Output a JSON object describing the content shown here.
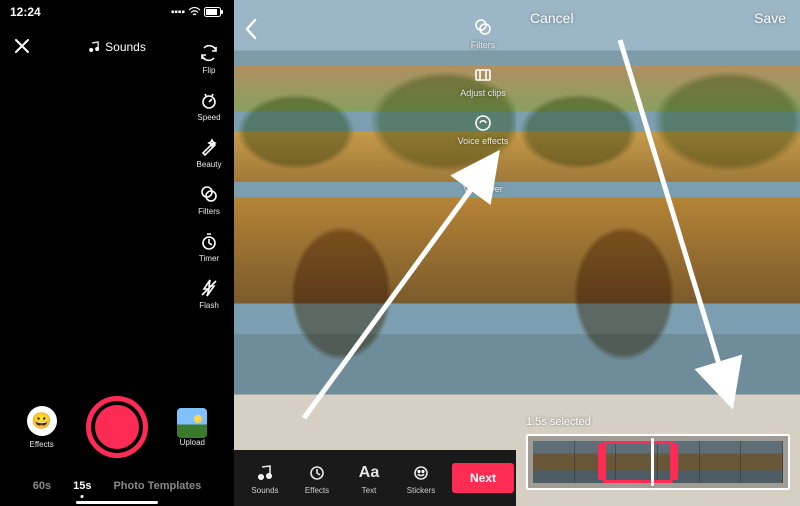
{
  "statusbar": {
    "time": "12:24"
  },
  "panel1": {
    "sounds_label": "Sounds",
    "tools": {
      "flip": "Flip",
      "speed": "Speed",
      "beauty": "Beauty",
      "filters": "Filters",
      "timer": "Timer",
      "flash": "Flash"
    },
    "effects_label": "Effects",
    "upload_label": "Upload",
    "modes": {
      "m60s": "60s",
      "m15s": "15s",
      "templates": "Photo Templates"
    }
  },
  "panel2": {
    "tools": {
      "filters": "Filters",
      "adjust_clips": "Adjust clips",
      "voice_effects": "Voice effects",
      "voiceover": "Voiceover"
    },
    "toolbar": {
      "sounds": "Sounds",
      "effects": "Effects",
      "text": "Text",
      "stickers": "Stickers",
      "text_glyph": "Aa"
    },
    "next_label": "Next"
  },
  "panel3": {
    "cancel": "Cancel",
    "save": "Save",
    "selected_label": "1.5s selected"
  },
  "icons": {
    "signal": "▮▮▮▮",
    "wifi": "䷾",
    "battery": "▮▮▯"
  }
}
